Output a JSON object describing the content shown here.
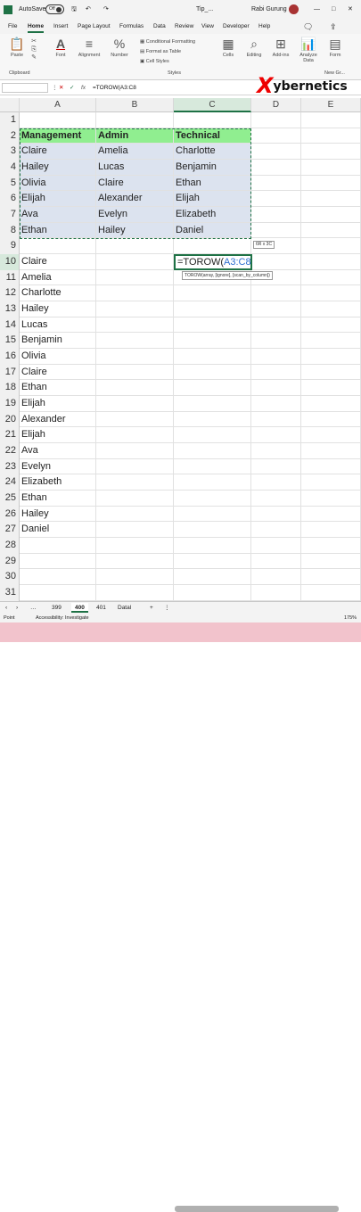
{
  "titlebar": {
    "autosave_label": "AutoSave",
    "autosave_state": "Off",
    "filename": "Tip_...",
    "user": "Rabi Gurung"
  },
  "ribbon_tabs": [
    "File",
    "Home",
    "Insert",
    "Page Layout",
    "Formulas",
    "Data",
    "Review",
    "View",
    "Developer",
    "Help"
  ],
  "ribbon": {
    "paste": "Paste",
    "clipboard": "Clipboard",
    "font": "Font",
    "alignment": "Alignment",
    "number": "Number",
    "conditional_formatting": "Conditional Formatting",
    "format_as_table": "Format as Table",
    "cell_styles": "Cell Styles",
    "styles": "Styles",
    "cells": "Cells",
    "editing": "Editing",
    "add_ins": "Add-ins",
    "add_ins_group": "Add-ins",
    "analyze_data": "Analyze Data",
    "form": "Form",
    "new_group": "New Gr..."
  },
  "formula_bar": {
    "fx": "fx",
    "formula": "=TOROW(A3:C8"
  },
  "watermark": "ybernetics",
  "columns": [
    "A",
    "B",
    "C",
    "D",
    "E"
  ],
  "rows": [
    "1",
    "2",
    "3",
    "4",
    "5",
    "6",
    "7",
    "8",
    "9",
    "10",
    "11",
    "12",
    "13",
    "14",
    "15",
    "16",
    "17",
    "18",
    "19",
    "20",
    "21",
    "22",
    "23",
    "24",
    "25",
    "26",
    "27",
    "28",
    "29",
    "30",
    "31"
  ],
  "table": {
    "headers": [
      "Management",
      "Admin",
      "Technical"
    ],
    "data": [
      [
        "Claire",
        "Amelia",
        "Charlotte"
      ],
      [
        "Hailey",
        "Lucas",
        "Benjamin"
      ],
      [
        "Olivia",
        "Claire",
        "Ethan"
      ],
      [
        "Elijah",
        "Alexander",
        "Elijah"
      ],
      [
        "Ava",
        "Evelyn",
        "Elizabeth"
      ],
      [
        "Ethan",
        "Hailey",
        "Daniel"
      ]
    ]
  },
  "column_a_list": [
    "Claire",
    "Amelia",
    "Charlotte",
    "Hailey",
    "Lucas",
    "Benjamin",
    "Olivia",
    "Claire",
    "Ethan",
    "Elijah",
    "Alexander",
    "Elijah",
    "Ava",
    "Evelyn",
    "Elizabeth",
    "Ethan",
    "Hailey",
    "Daniel"
  ],
  "active_cell": {
    "fn": "=TOROW(",
    "ref": "A3:C8"
  },
  "size_tip": "6R x 3C",
  "syntax_tip": "TOROW(array, [ignore], [scan_by_column])",
  "sheets": [
    "399",
    "400",
    "401",
    "Datal"
  ],
  "active_sheet": "400",
  "status": {
    "mode": "Point",
    "accessibility": "Accessibility: Investigate",
    "zoom": "175%"
  },
  "colors": {
    "header_fill": "#90ee90",
    "data_fill": "#dce3ef",
    "accent": "#1e7145",
    "range_ref": "#2f6fd0"
  }
}
